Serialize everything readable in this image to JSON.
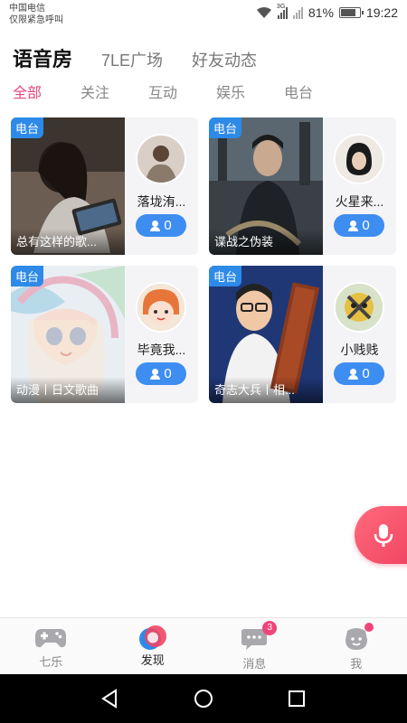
{
  "status_bar": {
    "carrier_line1": "中国电信",
    "carrier_line2": "仅限紧急呼叫",
    "network": "3G",
    "battery": "81%",
    "battery_level": 0.81,
    "time": "19:22"
  },
  "top_tabs": [
    {
      "label": "语音房",
      "active": true
    },
    {
      "label": "7LE广场",
      "active": false
    },
    {
      "label": "好友动态",
      "active": false
    }
  ],
  "sub_tabs": [
    {
      "label": "全部",
      "active": true
    },
    {
      "label": "关注",
      "active": false
    },
    {
      "label": "互动",
      "active": false
    },
    {
      "label": "娱乐",
      "active": false
    },
    {
      "label": "电台",
      "active": false
    }
  ],
  "rooms": [
    {
      "tag": "电台",
      "title": "总有这样的歌...",
      "host": "落垅洧...",
      "listeners": "0"
    },
    {
      "tag": "电台",
      "title": "谍战之伪装",
      "host": "火星来...",
      "listeners": "0"
    },
    {
      "tag": "电台",
      "title": "动漫丨日文歌曲",
      "host": "毕竟我...",
      "listeners": "0"
    },
    {
      "tag": "电台",
      "title": "奇志大兵丨相...",
      "host": "小贱贱",
      "listeners": "0"
    }
  ],
  "floating_button": {
    "icon": "microphone-icon"
  },
  "bottom_nav": [
    {
      "label": "七乐",
      "icon": "gamepad-icon",
      "active": false
    },
    {
      "label": "发现",
      "icon": "discover-icon",
      "active": true
    },
    {
      "label": "消息",
      "icon": "chat-bubble-icon",
      "active": false,
      "badge": "3"
    },
    {
      "label": "我",
      "icon": "profile-face-icon",
      "active": false,
      "dot": true
    }
  ],
  "system_nav": [
    "back-icon",
    "home-icon",
    "recents-icon"
  ],
  "colors": {
    "accent_pink": "#e8457f",
    "tag_blue": "#2d8ae8",
    "pill_blue": "#3e8df0",
    "mic_red": "#f04563"
  }
}
